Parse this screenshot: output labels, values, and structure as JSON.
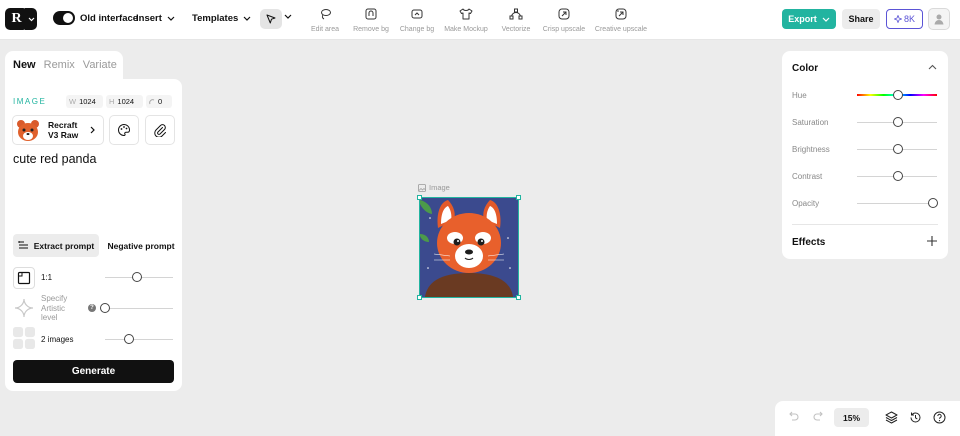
{
  "topbar": {
    "old_interface_label": "Old interface",
    "insert_label": "Insert",
    "templates_label": "Templates",
    "tools": [
      {
        "label": "Edit area",
        "icon": "lasso-icon"
      },
      {
        "label": "Remove bg",
        "icon": "remove-bg-icon"
      },
      {
        "label": "Change bg",
        "icon": "change-bg-icon"
      },
      {
        "label": "Make Mockup",
        "icon": "shirt-icon"
      },
      {
        "label": "Vectorize",
        "icon": "vectorize-icon"
      },
      {
        "label": "Crisp upscale",
        "icon": "crisp-upscale-icon"
      },
      {
        "label": "Creative upscale",
        "icon": "creative-upscale-icon"
      }
    ],
    "export_label": "Export",
    "share_label": "Share",
    "credits_label": "8K",
    "accent_color": "#22b4a0",
    "credits_color": "#5b54d6"
  },
  "left_panel": {
    "tabs": [
      "New",
      "Remix",
      "Variate"
    ],
    "active_tab": "New",
    "section_label": "IMAGE",
    "width_key": "W",
    "width_value": "1024",
    "height_key": "H",
    "height_value": "1024",
    "seed_value": "0",
    "model_name": "Recraft V3 Raw",
    "prompt": "cute red panda",
    "extract_prompt_label": "Extract prompt",
    "negative_prompt_label": "Negative prompt",
    "aspect_ratio_label": "1:1",
    "artistic_label": "Specify Artistic level",
    "images_count_label": "2 images",
    "generate_label": "Generate"
  },
  "canvas": {
    "frame_label": "Image"
  },
  "right_panel": {
    "color_title": "Color",
    "adjustments": [
      "Hue",
      "Saturation",
      "Brightness",
      "Contrast",
      "Opacity"
    ],
    "effects_title": "Effects"
  },
  "bottom_bar": {
    "zoom": "15%"
  }
}
